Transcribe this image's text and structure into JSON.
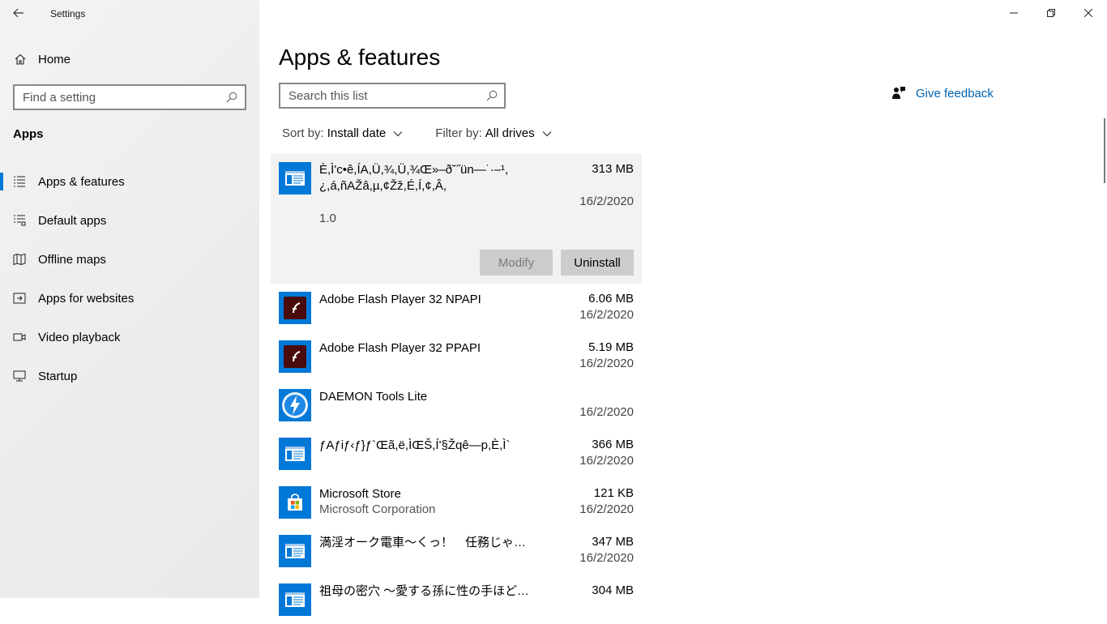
{
  "window": {
    "title": "Settings"
  },
  "sidebar": {
    "home_label": "Home",
    "search_placeholder": "Find a setting",
    "section_heading": "Apps",
    "items": [
      {
        "label": "Apps & features",
        "icon": "apps-features-icon",
        "active": true
      },
      {
        "label": "Default apps",
        "icon": "default-apps-icon",
        "active": false
      },
      {
        "label": "Offline maps",
        "icon": "offline-maps-icon",
        "active": false
      },
      {
        "label": "Apps for websites",
        "icon": "apps-for-websites-icon",
        "active": false
      },
      {
        "label": "Video playback",
        "icon": "video-playback-icon",
        "active": false
      },
      {
        "label": "Startup",
        "icon": "startup-icon",
        "active": false
      }
    ]
  },
  "main": {
    "title": "Apps & features",
    "search_placeholder": "Search this list",
    "sort": {
      "label": "Sort by:",
      "value": "Install date"
    },
    "filter": {
      "label": "Filter by:",
      "value": "All drives"
    },
    "feedback_label": "Give feedback",
    "buttons": {
      "modify": "Modify",
      "uninstall": "Uninstall"
    },
    "apps": [
      {
        "name": "È,Ì'c•ê,ÍA,Ü,¾,Ü,¾Œ»–ð˘˝ün—˙·–¹,¿,á,ñAŽâ,µ,¢Žž,É,Í,¢,Â,",
        "publisher": "",
        "size": "313 MB",
        "date": "16/2/2020",
        "version": "1.0",
        "icon": "generic-app-icon",
        "selected": true
      },
      {
        "name": "Adobe Flash Player 32 NPAPI",
        "publisher": "",
        "size": "6.06 MB",
        "date": "16/2/2020",
        "icon": "flash-player-icon"
      },
      {
        "name": "Adobe Flash Player 32 PPAPI",
        "publisher": "",
        "size": "5.19 MB",
        "date": "16/2/2020",
        "icon": "flash-player-icon"
      },
      {
        "name": "DAEMON Tools Lite",
        "publisher": "",
        "size": "",
        "date": "16/2/2020",
        "icon": "daemon-tools-icon"
      },
      {
        "name": "ƒAƒiƒ‹ƒ}ƒ`Œã,ë,ÌŒŠ,Í'§Žqê—p,È,Ì`",
        "publisher": "",
        "size": "366 MB",
        "date": "16/2/2020",
        "icon": "generic-app-icon"
      },
      {
        "name": "Microsoft Store",
        "publisher": "Microsoft Corporation",
        "size": "121 KB",
        "date": "16/2/2020",
        "icon": "microsoft-store-icon"
      },
      {
        "name": "満淫オーク電車〜くっ！　任務じゃなければこんな…",
        "publisher": "",
        "size": "347 MB",
        "date": "16/2/2020",
        "icon": "generic-app-icon"
      },
      {
        "name": "祖母の密穴 〜愛する孫に性の手ほどきを〜",
        "publisher": "",
        "size": "304 MB",
        "date": "",
        "icon": "generic-app-icon"
      }
    ]
  },
  "colors": {
    "accent": "#0078d7",
    "link": "#0063b1",
    "sidebar_bg": "#f0f0f0"
  }
}
